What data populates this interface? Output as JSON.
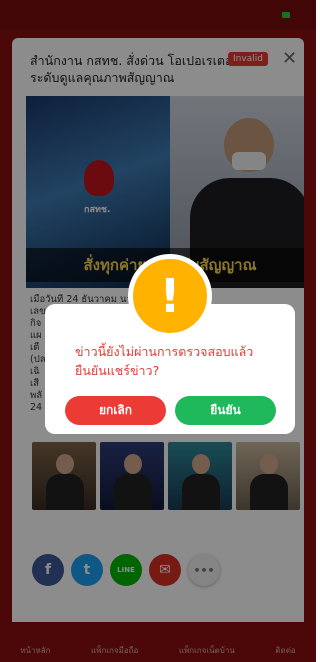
{
  "article": {
    "headline": "สำนักงาน กสทช. สั่งด่วน โอเปอเรเตอร์ ยกระดับดูแลคุณภาพสัญญาณ",
    "status_badge": "Invalid",
    "image": {
      "emblem_label": "กสทช.",
      "banner_text": "สั่งทุกค่ายยกระดับสัญญาณ"
    },
    "body_lines": [
      "เมื่อวันที่ 24 ธันวาคม นาย",
      "เลข",
      "กิจ",
      "แผ",
      "เตื",
      "(ปล",
      "เฉิ",
      "เสี",
      "พลั",
      "24"
    ]
  },
  "share": {
    "facebook": "f",
    "twitter": "t",
    "line": "LINE",
    "mail": "✉",
    "more": "•••"
  },
  "dialog": {
    "message": "ข่าวนี้ยังไม่ผ่านการตรวจสอบแล้ว ยืนยันแชร์ข่าว?",
    "cancel_label": "ยกเลิก",
    "confirm_label": "ยืนยัน",
    "alert_symbol": "!"
  },
  "bottom_nav": {
    "items": [
      "หน้าหลัก",
      "แพ็กเกจมือถือ",
      "แพ็กเกจเน็ตบ้าน",
      "ติดต่อ"
    ]
  },
  "colors": {
    "brand_red": "#8a0f0f",
    "alert_yellow": "#ffb300",
    "cancel_red": "#ec3b34",
    "confirm_green": "#1fb85a"
  }
}
